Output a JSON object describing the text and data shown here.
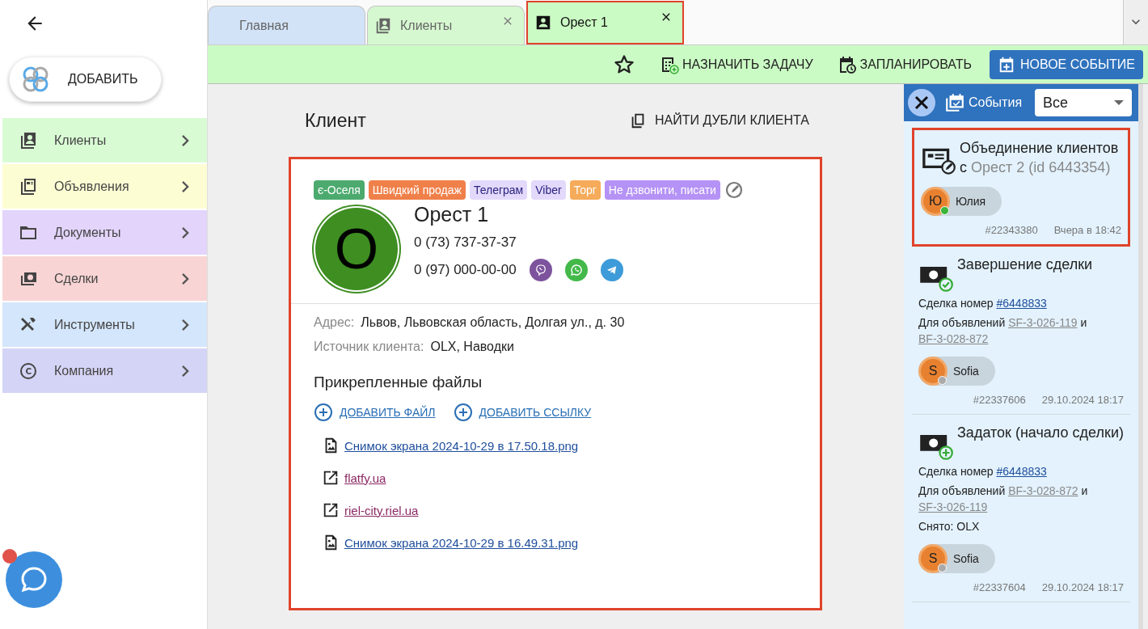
{
  "sidebar": {
    "add_button": "ДОБАВИТЬ",
    "items": [
      {
        "label": "Клиенты",
        "kind": "clients",
        "color": "#d9fbd4"
      },
      {
        "label": "Объявления",
        "kind": "listings",
        "color": "#fdfdd4"
      },
      {
        "label": "Документы",
        "kind": "documents",
        "color": "#e3d4fb"
      },
      {
        "label": "Сделки",
        "kind": "deals",
        "color": "#f9d4d4"
      },
      {
        "label": "Инструменты",
        "kind": "tools",
        "color": "#d4e6fb"
      },
      {
        "label": "Компания",
        "kind": "company",
        "color": "#d4d4f6"
      }
    ],
    "chat_unread": true
  },
  "tabs": [
    {
      "label": "Главная",
      "icon": false,
      "closable": false,
      "selected": false,
      "highlighted": false,
      "color": "#d2e3f7"
    },
    {
      "label": "Клиенты",
      "icon": true,
      "closable": true,
      "selected": false,
      "highlighted": false,
      "color": "#d6f8d0"
    },
    {
      "label": "Орест 1",
      "icon": true,
      "closable": true,
      "selected": true,
      "highlighted": true,
      "color": "#cbfbc4"
    }
  ],
  "toolbar": {
    "assign_task": "НАЗНАЧИТЬ ЗАДАЧУ",
    "schedule": "ЗАПЛАНИРОВАТЬ",
    "new_event": "НОВОЕ СОБЫТИЕ"
  },
  "page": {
    "title": "Клиент",
    "find_duplicates": "НАЙТИ ДУБЛИ КЛИЕНТА"
  },
  "client": {
    "highlighted": true,
    "tags": [
      {
        "label": "є-Оселя",
        "color": "#4caa6e"
      },
      {
        "label": "Швидкий продаж",
        "color": "#f0804a"
      },
      {
        "label": "Телеграм",
        "color": "#e2d9fb"
      },
      {
        "label": "Viber",
        "color": "#e2d9fb"
      },
      {
        "label": "Торг",
        "color": "#f5ab5a"
      },
      {
        "label": "Не дзвонити, писати",
        "color": "#b592f5"
      }
    ],
    "avatar_letter": "О",
    "name": "Орест 1",
    "phones": [
      {
        "number": "0 (73) 737-37-37"
      },
      {
        "number": "0 (97) 000-00-00",
        "messengers": [
          {
            "kind": "viber"
          },
          {
            "kind": "whatsapp"
          },
          {
            "kind": "telegram"
          }
        ]
      }
    ],
    "fields": [
      {
        "label": "Адрес:",
        "value": "Львов, Львовская область, Долгая ул., д. 30"
      },
      {
        "label": "Источник клиента:",
        "value": "OLX, Наводки"
      }
    ],
    "files_title": "Прикрепленные файлы",
    "add_file": "ДОБАВИТЬ ФАЙЛ",
    "add_link": "ДОБАВИТЬ ССЫЛКУ",
    "files": [
      {
        "kind": "image",
        "label": "Снимок экрана 2024-10-29 в 17.50.18.png"
      },
      {
        "kind": "link",
        "label": "flatfy.ua"
      },
      {
        "kind": "link",
        "label": "riel-city.riel.ua"
      },
      {
        "kind": "image",
        "label": "Снимок экрана 2024-10-29 в 16.49.31.png"
      }
    ]
  },
  "events_panel": {
    "title": "События",
    "filter": "Все",
    "events": [
      {
        "kind": "merge",
        "title": "Объединение клиентов с",
        "title_extra": "Орест 2 (id 6443354)",
        "highlighted": true,
        "user": {
          "letter": "Ю",
          "name": "Юлия",
          "online": true
        },
        "number": "#22343380",
        "time": "Вчера в 18:42"
      },
      {
        "kind": "deal_done",
        "title": "Завершение сделки",
        "highlighted": false,
        "lines": [
          [
            {
              "kind": "text",
              "text": "Сделка номер"
            },
            {
              "kind": "deal",
              "text": "#6448833"
            }
          ],
          [
            {
              "kind": "text",
              "text": "Для объявлений"
            },
            {
              "kind": "listing",
              "text": "SF-3-026-119"
            },
            {
              "kind": "text",
              "text": "и"
            },
            {
              "kind": "listing",
              "text": "BF-3-028-872"
            }
          ]
        ],
        "user": {
          "letter": "S",
          "name": "Sofia",
          "online": false
        },
        "number": "#22337606",
        "time": "29.10.2024 18:17"
      },
      {
        "kind": "deposit",
        "title": "Задаток (начало сделки)",
        "highlighted": false,
        "lines": [
          [
            {
              "kind": "text",
              "text": "Сделка номер"
            },
            {
              "kind": "deal",
              "text": "#6448833"
            }
          ],
          [
            {
              "kind": "text",
              "text": "Для объявлений"
            },
            {
              "kind": "listing",
              "text": "BF-3-028-872"
            },
            {
              "kind": "text",
              "text": "и"
            },
            {
              "kind": "listing",
              "text": "SF-3-026-119"
            }
          ],
          [
            {
              "kind": "text",
              "text": "Снято: OLX"
            }
          ]
        ],
        "user": {
          "letter": "S",
          "name": "Sofia",
          "online": false
        },
        "number": "#22337604",
        "time": "29.10.2024 18:17"
      }
    ]
  }
}
